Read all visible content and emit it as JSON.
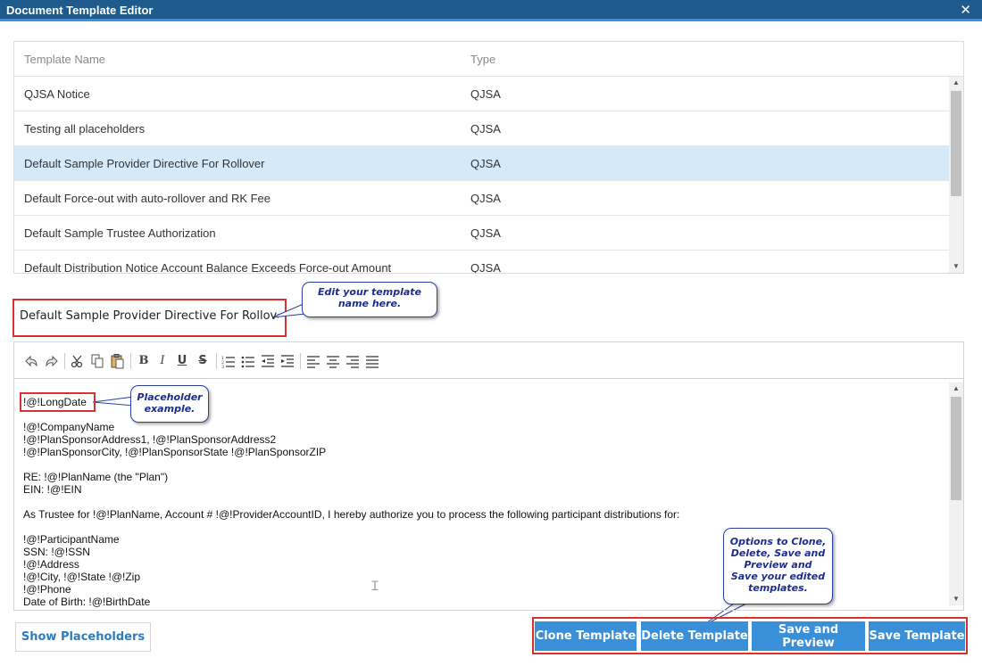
{
  "window": {
    "title": "Document Template Editor",
    "close_glyph": "✕"
  },
  "grid": {
    "columns": [
      "Template Name",
      "Type"
    ],
    "rows": [
      {
        "name": "QJSA Notice",
        "type": "QJSA"
      },
      {
        "name": "Testing all placeholders",
        "type": "QJSA"
      },
      {
        "name": "Default Sample Provider Directive For Rollover",
        "type": "QJSA"
      },
      {
        "name": "Default Force-out with auto-rollover and RK Fee",
        "type": "QJSA"
      },
      {
        "name": "Default Sample Trustee Authorization",
        "type": "QJSA"
      },
      {
        "name": "Default Distribution Notice Account Balance Exceeds Force-out Amount",
        "type": "QJSA"
      }
    ],
    "selected_row": "Default Sample Provider Directive For Rollover"
  },
  "template_name": {
    "value": "Default Sample Provider Directive For Rollover"
  },
  "callouts": {
    "name": "Edit your template name here.",
    "placeholder": "Placeholder example.",
    "options": "Options to Clone, Delete, Save and Preview and Save your edited templates."
  },
  "toolbar": {
    "undo_icon": "undo-icon",
    "redo_icon": "redo-icon",
    "cut_icon": "scissors-icon",
    "copy_icon": "copy-icon",
    "paste_icon": "paste-icon",
    "bold": "B",
    "italic": "I",
    "underline": "U",
    "strike": "S"
  },
  "editor": {
    "lines": [
      "!@!LongDate",
      "",
      "!@!CompanyName",
      "!@!PlanSponsorAddress1, !@!PlanSponsorAddress2",
      "!@!PlanSponsorCity, !@!PlanSponsorState  !@!PlanSponsorZIP",
      "",
      "RE: !@!PlanName (the \"Plan\")",
      "EIN: !@!EIN",
      "",
      "As Trustee for !@!PlanName, Account # !@!ProviderAccountID, I hereby authorize you to process the following participant distributions for:",
      "",
      "!@!ParticipantName",
      "SSN: !@!SSN",
      "!@!Address",
      "!@!City, !@!State !@!Zip",
      "!@!Phone",
      "Date of Birth: !@!BirthDate"
    ]
  },
  "buttons": {
    "show_placeholders": "Show Placeholders",
    "clone": "Clone Template",
    "delete": "Delete Template",
    "save_preview": "Save and Preview",
    "save": "Save Template"
  },
  "colors": {
    "titlebar": "#1f5a8c",
    "accent": "#3a8fd9",
    "selected_row": "#d5e9f9",
    "highlight_box": "#d93030",
    "callout_text": "#1c2d8f"
  }
}
